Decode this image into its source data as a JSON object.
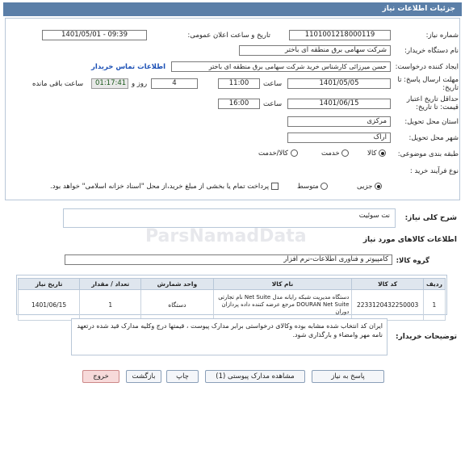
{
  "page": {
    "header_title": "جزئیات اطلاعات نیاز"
  },
  "form": {
    "need_number_label": "شماره نیاز:",
    "need_number": "1101001218000119",
    "announce_label": "تاریخ و ساعت اعلان عمومی:",
    "announce_value": "1401/05/01 - 09:39",
    "buyer_org_label": "نام دستگاه خریدار:",
    "buyer_org": "شرکت سهامی برق منطقه ای باختر",
    "creator_label": "ایجاد کننده درخواست:",
    "creator": "حسن میرزائی کارشناس خرید شرکت سهامی برق منطقه ای باختر",
    "buyer_contact_link": "اطلاعات تماس خریدار",
    "reply_deadline_label": "مهلت ارسال پاسخ: تا تاریخ:",
    "reply_date": "1401/05/05",
    "reply_time_label": "ساعت",
    "reply_time": "11:00",
    "days_value": "4",
    "days_label": "روز و",
    "remaining_time": "01:17:41",
    "remaining_label": "ساعت باقی مانده",
    "validity_label": "حداقل تاریخ اعتبار قیمت: تا تاریخ:",
    "validity_date": "1401/06/15",
    "validity_time_label": "ساعت",
    "validity_time": "16:00",
    "province_label": "استان محل تحویل:",
    "province": "مرکزی",
    "city_label": "شهر محل تحویل:",
    "city": "اراک",
    "category_label": "طبقه بندی موضوعی:",
    "category_options": [
      "کالا",
      "خدمت",
      "کالا/خدمت"
    ],
    "process_label": "نوع فرآیند خرید :",
    "process_options": [
      "جزیی",
      "متوسط"
    ],
    "payment_note": "پرداخت تمام یا بخشی از مبلغ خرید،از محل \"اسناد خزانه اسلامی\" خواهد بود."
  },
  "summary": {
    "label": "شرح کلی نیاز:",
    "value": "نت سوئیت"
  },
  "goods": {
    "section_title": "اطلاعات کالاهای مورد نیاز",
    "group_label": "گروه کالا:",
    "group_value": "کامپیوتر و فناوری اطلاعات-نرم افزار",
    "columns": [
      "ردیف",
      "کد کالا",
      "نام کالا",
      "واحد شمارش",
      "تعداد / مقدار",
      "تاریخ نیاز"
    ],
    "rows": [
      {
        "row": "1",
        "code": "2233120432250003",
        "name": "دستگاه مدیریت شبکه رایانه مدل Net Suite نام تجارتی DOURAN Net Suite مرجع عرضه کننده داده پردازان دوران",
        "unit": "دستگاه",
        "qty": "1",
        "date": "1401/06/15"
      }
    ]
  },
  "buyer_notes": {
    "label": "توضیحات خریدار:",
    "text": "ایران کد انتخاب شده مشابه بوده وکالای درخواستی برابر مدارک پیوست ، قیمتها درج وکلیه مدارک قید شده درتعهد نامه مهر وامضاء و بارگذاری شود."
  },
  "buttons": {
    "reply": "پاسخ به نیاز",
    "view_docs": "مشاهده مدارک پیوستی (1)",
    "print": "چاپ",
    "back": "بازگشت",
    "exit": "خروج"
  },
  "watermark": {
    "brand": "ParsNamadData"
  }
}
